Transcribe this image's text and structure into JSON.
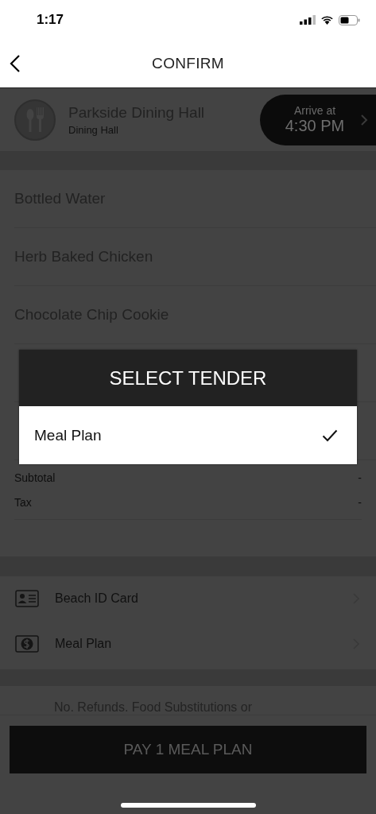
{
  "status_bar": {
    "time": "1:17"
  },
  "nav": {
    "title": "CONFIRM"
  },
  "location": {
    "name": "Parkside Dining Hall",
    "type": "Dining Hall",
    "arrive_label": "Arrive at",
    "arrive_time": "4:30 PM"
  },
  "items": [
    {
      "name": "Bottled Water"
    },
    {
      "name": "Herb Baked Chicken"
    },
    {
      "name": "Chocolate Chip Cookie"
    }
  ],
  "totals": [
    {
      "label": "Subtotal",
      "value": "-"
    },
    {
      "label": "Tax",
      "value": "-"
    }
  ],
  "payment_methods": [
    {
      "kind": "id_card",
      "label": "Beach ID Card"
    },
    {
      "kind": "meal_plan",
      "label": "Meal Plan"
    }
  ],
  "notice": "No. Refunds. Food Substitutions or",
  "pay_button": "PAY 1 MEAL PLAN",
  "dialog": {
    "title": "SELECT TENDER",
    "options": [
      {
        "label": "Meal Plan",
        "selected": true
      }
    ]
  }
}
